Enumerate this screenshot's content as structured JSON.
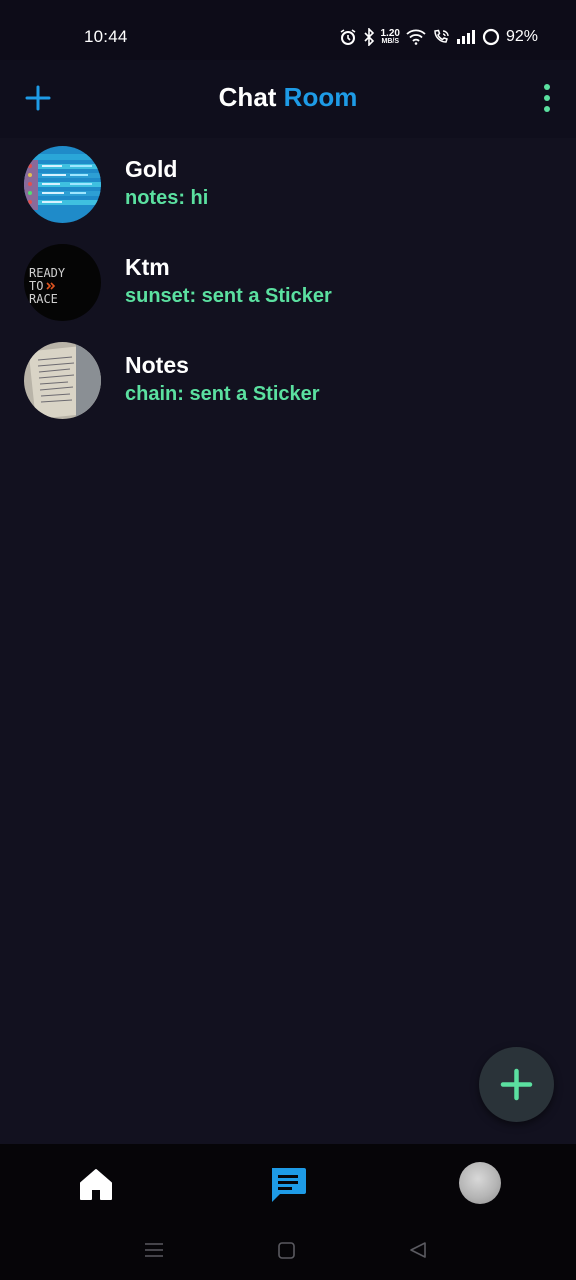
{
  "status_bar": {
    "time": "10:44",
    "net_speed_value": "1.20",
    "net_speed_unit": "MB/S",
    "battery": "92%",
    "icons": [
      "alarm-icon",
      "bluetooth-icon",
      "wifi-icon",
      "wifi-call-icon",
      "signal-icon",
      "battery-icon"
    ]
  },
  "header": {
    "title_part1": "Chat",
    "title_part2": "Room",
    "add_icon": "plus-icon",
    "menu_icon": "more-vertical-icon",
    "accent_color": "#1e9be6"
  },
  "chats": [
    {
      "name": "Gold",
      "preview": "notes: hi",
      "avatar": "screenshot-thumbnail"
    },
    {
      "name": "Ktm",
      "preview": "sunset: sent a Sticker",
      "avatar": "ready-to-race-logo",
      "avatar_text": [
        "READY",
        "TO",
        "RACE"
      ]
    },
    {
      "name": "Notes",
      "preview": "chain: sent a Sticker",
      "avatar": "paper-notes-photo"
    }
  ],
  "preview_color": "#5be0a0",
  "fab": {
    "icon": "plus-icon",
    "color": "#5be0a0"
  },
  "bottom_nav": {
    "items": [
      "home-icon",
      "chat-icon",
      "profile-avatar"
    ],
    "active": "chat-icon",
    "active_color": "#1e9be6"
  },
  "system_nav": [
    "menu-icon",
    "home-square-icon",
    "back-triangle-icon"
  ]
}
